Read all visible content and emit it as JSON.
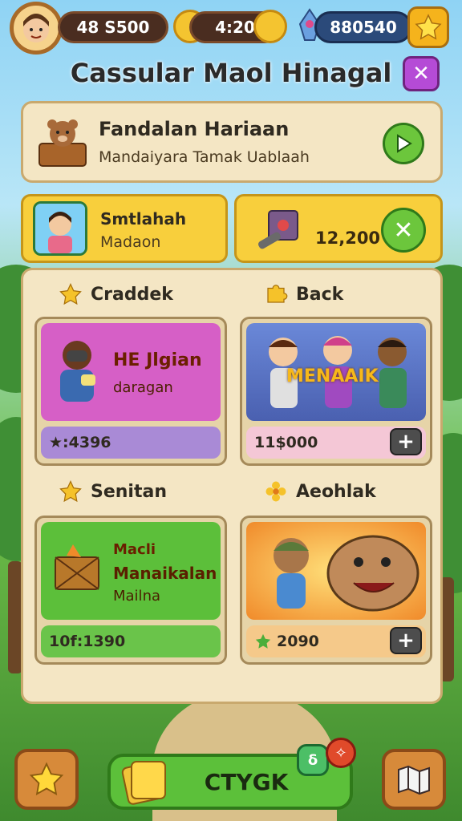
{
  "header": {
    "avatar_icon": "player-avatar-icon",
    "resource_1": "48 S500",
    "resource_2": "4:20",
    "resource_3": "880540",
    "star_icon": "star-icon"
  },
  "title": "Cassular Maol Hinagal",
  "close_label": "✕",
  "daily": {
    "title": "Fandalan Hariaan",
    "subtitle": "Mandaiyara Tamak Uablaah"
  },
  "row2": {
    "card1_title": "Smtlahah",
    "card1_sub": "Madaon",
    "card2_value": "12,200"
  },
  "sections": {
    "s1": "Craddek",
    "s2": "Back",
    "s3": "Senitan",
    "s4": "Aeohlak"
  },
  "items": {
    "i1_title": "HE Jlgian",
    "i1_sub": "daragan",
    "i1_price": "★:4396",
    "i2_art_label": "MENAAIK",
    "i2_price": "11$000",
    "i3_line1": "Macli",
    "i3_line2": "Manaikalan",
    "i3_line3": "Mailna",
    "i3_price": "10f:1390",
    "i4_price": "2090"
  },
  "bottom": {
    "main_label": "CTYGK",
    "badge_green": "δ",
    "badge_red": "✧"
  },
  "colors": {
    "gold": "#f8cf3c",
    "green": "#5cc03a",
    "purple": "#b54bd6",
    "pink": "#d65fc6"
  }
}
